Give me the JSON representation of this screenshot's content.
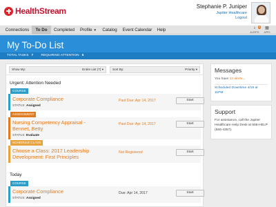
{
  "app": {
    "brand": "HealthStream"
  },
  "user": {
    "name": "Stephanie P. Juniper",
    "org": "Jupiter Healthcare",
    "logout": "Logout"
  },
  "nav": {
    "items": [
      {
        "label": "Connections"
      },
      {
        "label": "To Do",
        "active": true
      },
      {
        "label": "Completed"
      },
      {
        "label": "Profile"
      },
      {
        "label": "Catalog"
      },
      {
        "label": "Event Calendar"
      },
      {
        "label": "Help"
      }
    ],
    "alerts": {
      "label": "ALERTS",
      "count": "4",
      "icon": "bell-icon"
    },
    "apps": {
      "label": "APPS",
      "icon": "grid-icon"
    }
  },
  "page": {
    "title": "My To-Do List",
    "total_tasks_label": "TOTAL TASKS",
    "total_tasks": "7",
    "requiring_attention_label": "REQUIRING ATTENTION",
    "requiring_attention": "5"
  },
  "filters": {
    "show_my_label": "Show My:",
    "show_my_value": "Entire List (7)",
    "sort_by_label": "Sort By:",
    "sort_by_value": "Priority"
  },
  "sections": {
    "urgent": "Urgent: Attention Needed",
    "today": "Today"
  },
  "tasks": [
    {
      "tag": "Course",
      "title": "Corporate Compliance",
      "status_label": "STATUS:",
      "status": "Assigned",
      "due": "Past Due: Apr 14, 2017",
      "action": "Start"
    },
    {
      "tag": "Assessment",
      "title_line1": "Nursing Competency Appraisal -",
      "title_line2": "Bennet, Betty",
      "status_label": "STATUS:",
      "status": "Evaluate",
      "due": "Past Due: Apr 14, 2017",
      "action": "Start"
    },
    {
      "tag": "Schedule Class",
      "title_line1": "Choose a Class: 2017 Leadership",
      "title_line2": "Development: First Principles",
      "due": "Not Registered",
      "action": "Start"
    },
    {
      "tag": "Course",
      "title": "Corporate Compliance",
      "status_label": "STATUS:",
      "status": "Assigned",
      "due": "Due: Apr 14, 2017",
      "action": "Start"
    }
  ],
  "messages": {
    "title": "Messages",
    "alerts_prefix": "You have ",
    "alerts_count": "12 alerts",
    "alerts_suffix": "...",
    "downtime_line1": "Scheduled Downtime 4/19 at",
    "downtime_line2": "11PM"
  },
  "support": {
    "title": "Support",
    "line1": "For assistance, call the Jupiter",
    "line2": "Healthcare Help Desk at 555-HELP",
    "line3": "(555-4357)."
  },
  "colors": {
    "brand_red": "#c8102e",
    "banner_blue": "#2a8fd8",
    "course_tag": "#2a9dc8",
    "assessment_tag": "#e07b1f",
    "schedule_tag": "#e8a33c",
    "past_due": "#e07b1f",
    "link_blue": "#1f6fb0"
  }
}
